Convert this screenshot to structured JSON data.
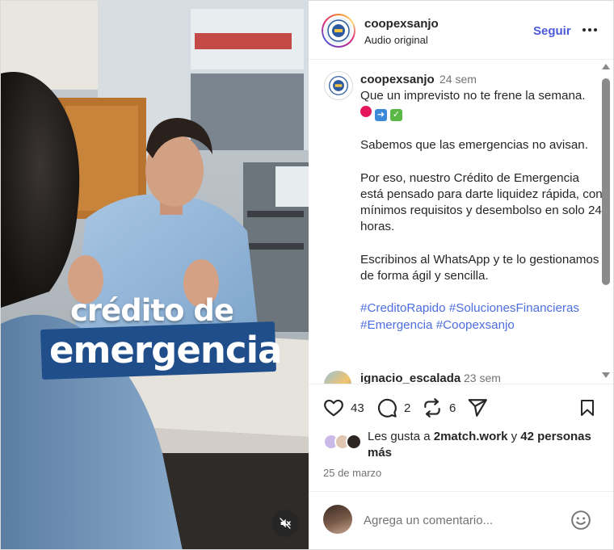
{
  "video": {
    "overlay_line1": "crédito de",
    "overlay_line2": "emergencia",
    "mute_icon": "speaker-muted-icon"
  },
  "header": {
    "username": "coopexsanjo",
    "subtitle": "Audio original",
    "follow_label": "Seguir",
    "more_icon": "more-options-icon"
  },
  "post": {
    "username": "coopexsanjo",
    "time": "24 sem",
    "caption_intro": "Que un imprevisto no te frene la semana.",
    "caption_emojis": [
      "red-circle-icon",
      "right-arrow-icon",
      "check-mark-icon"
    ],
    "caption_paragraphs": [
      " Sabemos que las emergencias no avisan.",
      "Por eso, nuestro Crédito de Emergencia está pensado para darte liquidez rápida, con mínimos requisitos y desembolso en solo 24 horas.",
      "Escribinos al WhatsApp y te lo gestionamos de forma ágil y sencilla."
    ],
    "hashtags": [
      "#CreditoRapido",
      "#SolucionesFinancieras",
      "#Emergencia",
      "#Coopexsanjo"
    ]
  },
  "next_comment": {
    "username": "ignacio_escalada",
    "time": "23 sem"
  },
  "actions": {
    "like_count": "43",
    "comment_count": "2",
    "repost_count": "6"
  },
  "likes": {
    "prefix": "Les gusta a ",
    "first_user": "2match.work",
    "connector": " y ",
    "others": "42 personas más"
  },
  "date": "25 de marzo",
  "add_comment": {
    "placeholder": "Agrega un comentario..."
  },
  "colors": {
    "accent_blue": "#4c5ad9",
    "hashtag_blue": "#4c6ee0",
    "muted_text": "#737373",
    "overlay_band": "#1f4e8a"
  }
}
